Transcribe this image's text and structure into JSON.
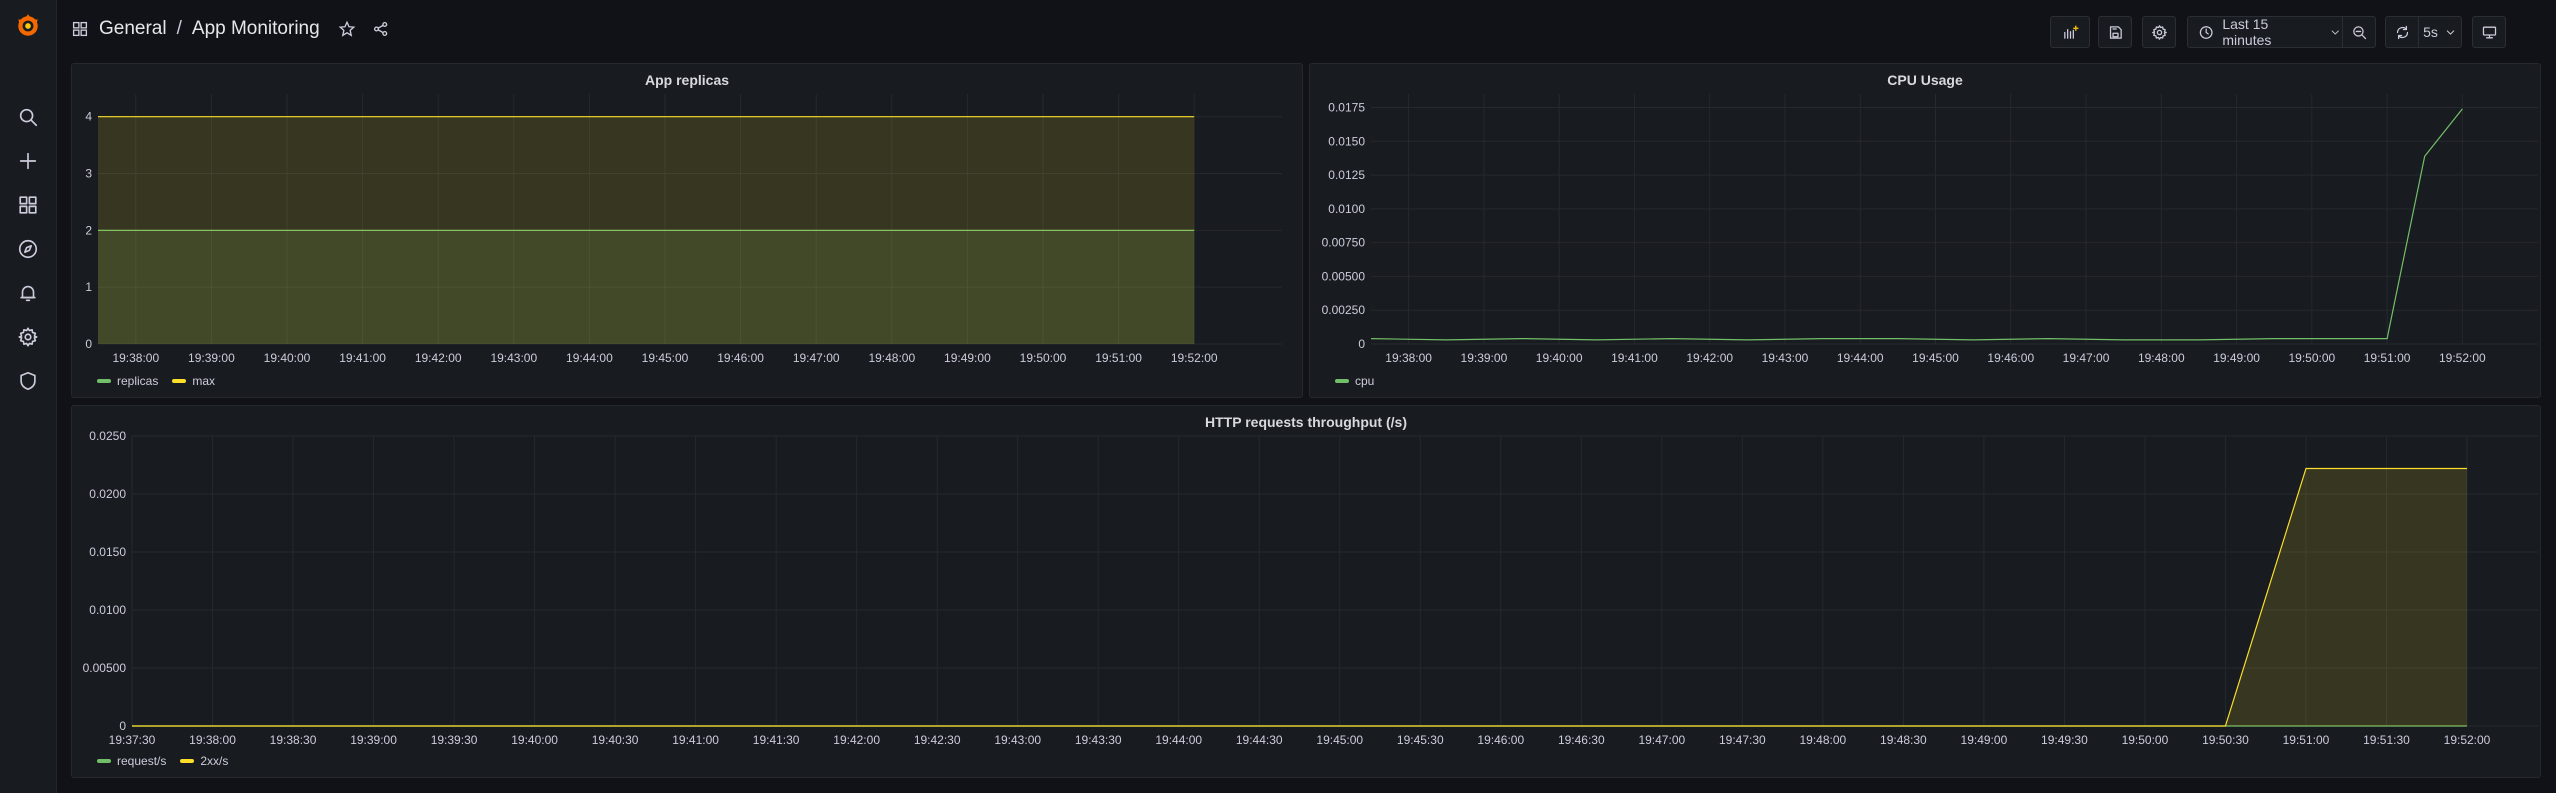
{
  "breadcrumb": {
    "folder": "General",
    "separator": "/",
    "dashboard": "App Monitoring"
  },
  "toolbar": {
    "time_range": "Last 15 minutes",
    "refresh_interval": "5s"
  },
  "sidebar": {
    "items": [
      "grafana-logo-icon",
      "search-icon",
      "create-icon",
      "dashboards-icon",
      "explore-icon",
      "alerting-icon",
      "configuration-icon",
      "server-admin-icon"
    ]
  },
  "colors": {
    "green": "#73bf69",
    "yellow": "#fade2a",
    "bg": "#111217",
    "panel": "#181b1f"
  },
  "panels": {
    "replicas": {
      "title": "App replicas",
      "legend": [
        "replicas",
        "max"
      ]
    },
    "cpu": {
      "title": "CPU Usage",
      "legend": [
        "cpu"
      ]
    },
    "http": {
      "title": "HTTP requests throughput (/s)",
      "legend": [
        "request/s",
        "2xx/s"
      ]
    }
  },
  "chart_data": [
    {
      "type": "area",
      "title": "App replicas",
      "x": [
        "19:37:30",
        "19:52:00"
      ],
      "x_ticks": [
        "19:38:00",
        "19:39:00",
        "19:40:00",
        "19:41:00",
        "19:42:00",
        "19:43:00",
        "19:44:00",
        "19:45:00",
        "19:46:00",
        "19:47:00",
        "19:48:00",
        "19:49:00",
        "19:50:00",
        "19:51:00",
        "19:52:00"
      ],
      "y_ticks": [
        "0",
        "1",
        "2",
        "3",
        "4"
      ],
      "ylim": [
        0,
        4.4
      ],
      "series": [
        {
          "name": "replicas",
          "color": "#73bf69",
          "values": [
            2,
            2
          ]
        },
        {
          "name": "max",
          "color": "#fade2a",
          "values": [
            4,
            4
          ]
        }
      ],
      "grid": true,
      "legend": "bottom-left"
    },
    {
      "type": "line",
      "title": "CPU Usage",
      "x": [
        "19:37:30",
        "19:38:30",
        "19:39:30",
        "19:40:30",
        "19:41:30",
        "19:42:30",
        "19:43:30",
        "19:44:30",
        "19:45:30",
        "19:46:30",
        "19:47:30",
        "19:48:30",
        "19:49:30",
        "19:50:30",
        "19:51:00",
        "19:51:30",
        "19:52:00"
      ],
      "x_ticks": [
        "19:38:00",
        "19:39:00",
        "19:40:00",
        "19:41:00",
        "19:42:00",
        "19:43:00",
        "19:44:00",
        "19:45:00",
        "19:46:00",
        "19:47:00",
        "19:48:00",
        "19:49:00",
        "19:50:00",
        "19:51:00",
        "19:52:00"
      ],
      "y_ticks": [
        "0",
        "0.00250",
        "0.00500",
        "0.00750",
        "0.0100",
        "0.0125",
        "0.0150",
        "0.0175"
      ],
      "ylim": [
        0,
        0.0185
      ],
      "series": [
        {
          "name": "cpu",
          "color": "#73bf69",
          "values": [
            0.0004,
            0.0003,
            0.0004,
            0.0003,
            0.0004,
            0.0003,
            0.0004,
            0.0004,
            0.0003,
            0.0004,
            0.0003,
            0.0003,
            0.0004,
            0.0004,
            0.0004,
            0.0139,
            0.0174
          ]
        }
      ],
      "grid": true,
      "legend": "bottom-left"
    },
    {
      "type": "area",
      "title": "HTTP requests throughput (/s)",
      "x": [
        "19:37:30",
        "19:50:30",
        "19:51:00",
        "19:52:00"
      ],
      "x_ticks": [
        "19:37:30",
        "19:38:00",
        "19:38:30",
        "19:39:00",
        "19:39:30",
        "19:40:00",
        "19:40:30",
        "19:41:00",
        "19:41:30",
        "19:42:00",
        "19:42:30",
        "19:43:00",
        "19:43:30",
        "19:44:00",
        "19:44:30",
        "19:45:00",
        "19:45:30",
        "19:46:00",
        "19:46:30",
        "19:47:00",
        "19:47:30",
        "19:48:00",
        "19:48:30",
        "19:49:00",
        "19:49:30",
        "19:50:00",
        "19:50:30",
        "19:51:00",
        "19:51:30",
        "19:52:00"
      ],
      "y_ticks": [
        "0",
        "0.00500",
        "0.0100",
        "0.0150",
        "0.0200",
        "0.0250"
      ],
      "ylim": [
        0,
        0.025
      ],
      "series": [
        {
          "name": "request/s",
          "color": "#73bf69",
          "values": [
            0,
            0,
            0,
            0
          ]
        },
        {
          "name": "2xx/s",
          "color": "#fade2a",
          "values": [
            0,
            0,
            0.0222,
            0.0222
          ]
        }
      ],
      "grid": true,
      "legend": "bottom-left"
    }
  ]
}
